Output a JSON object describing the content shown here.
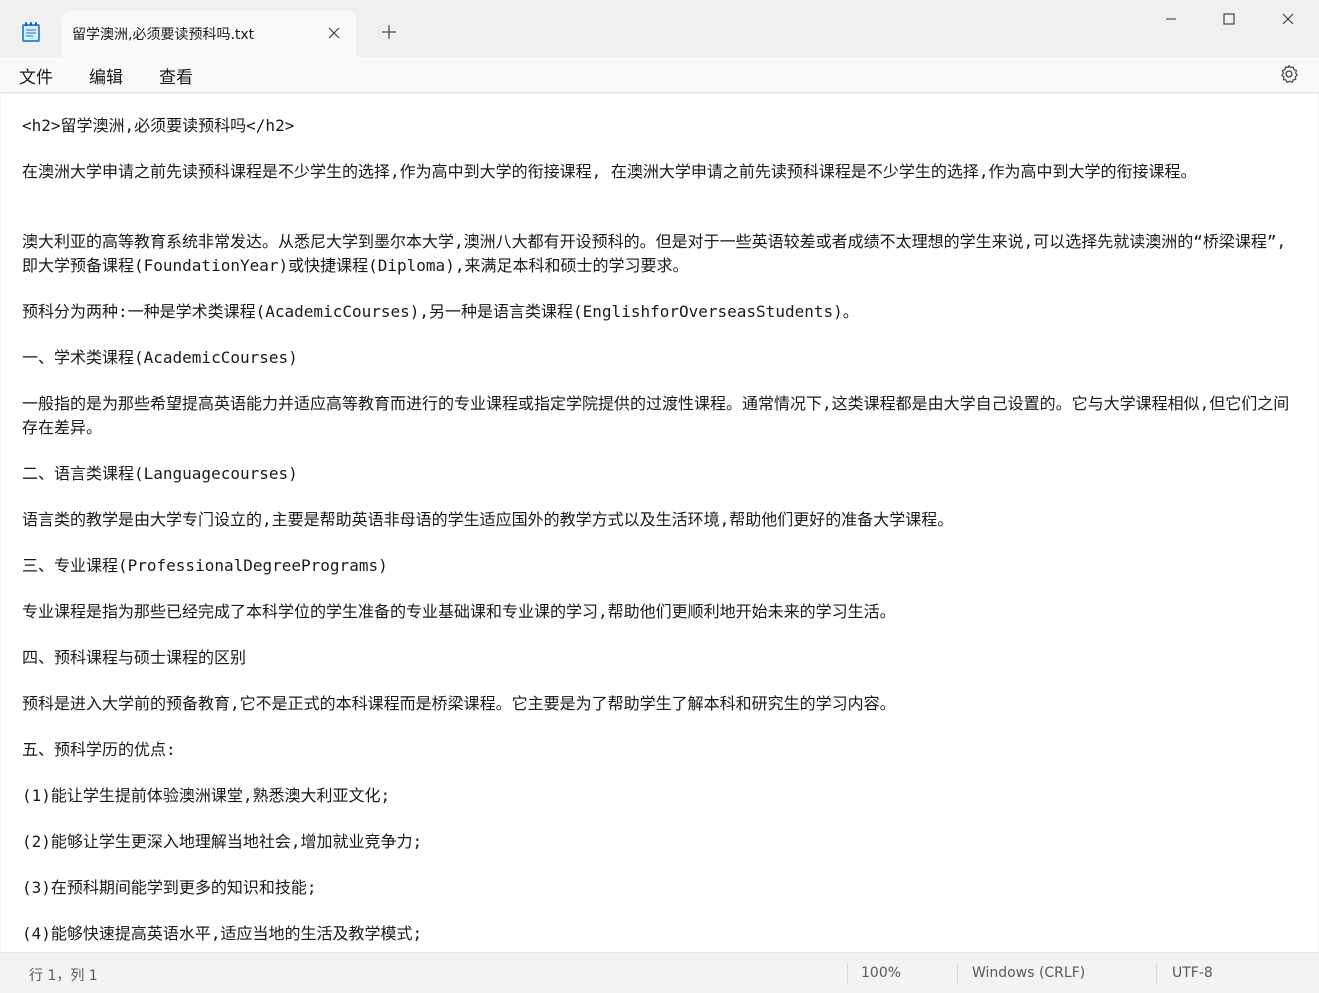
{
  "tab": {
    "title": "留学澳洲,必须要读预科吗.txt"
  },
  "menu": {
    "file": "文件",
    "edit": "编辑",
    "view": "查看"
  },
  "content": {
    "paragraphs": [
      "<h2>留学澳洲,必须要读预科吗</h2>",
      "在澳洲大学申请之前先读预科课程是不少学生的选择,作为高中到大学的衔接课程, 在澳洲大学申请之前先读预科课程是不少学生的选择,作为高中到大学的衔接课程。",
      "澳大利亚的高等教育系统非常发达。从悉尼大学到墨尔本大学,澳洲八大都有开设预科的。但是对于一些英语较差或者成绩不太理想的学生来说,可以选择先就读澳洲的“桥梁课程”,即大学预备课程(FoundationYear)或快捷课程(Diploma),来满足本科和硕士的学习要求。",
      "预科分为两种:一种是学术类课程(AcademicCourses),另一种是语言类课程(EnglishforOverseasStudents)。",
      "一、学术类课程(AcademicCourses)",
      "一般指的是为那些希望提高英语能力并适应高等教育而进行的专业课程或指定学院提供的过渡性课程。通常情况下,这类课程都是由大学自己设置的。它与大学课程相似,但它们之间存在差异。",
      "二、语言类课程(Languagecourses)",
      "语言类的教学是由大学专门设立的,主要是帮助英语非母语的学生适应国外的教学方式以及生活环境,帮助他们更好的准备大学课程。",
      "三、专业课程(ProfessionalDegreePrograms)",
      "专业课程是指为那些已经完成了本科学位的学生准备的专业基础课和专业课的学习,帮助他们更顺利地开始未来的学习生活。",
      "四、预科课程与硕士课程的区别",
      "预科是进入大学前的预备教育,它不是正式的本科课程而是桥梁课程。它主要是为了帮助学生了解本科和研究生的学习内容。",
      "五、预科学历的优点:",
      "(1)能让学生提前体验澳洲课堂,熟悉澳大利亚文化;",
      "(2)能够让学生更深入地理解当地社会,增加就业竞争力;",
      "(3)在预科期间能学到更多的知识和技能;",
      "(4)能够快速提高英语水平,适应当地的生活及教学模式;"
    ]
  },
  "status": {
    "position": "行 1，列 1",
    "zoom": "100%",
    "line_ending": "Windows (CRLF)",
    "encoding": "UTF-8"
  }
}
